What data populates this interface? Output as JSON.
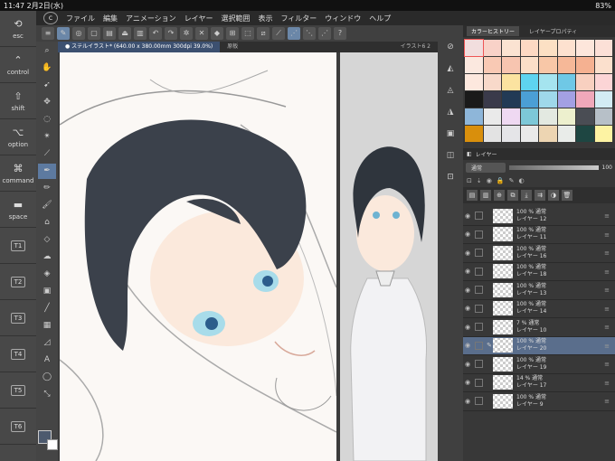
{
  "status": {
    "time": "11:47",
    "date": "2月2日(水)",
    "battery": "83%"
  },
  "menu": [
    "ファイル",
    "編集",
    "アニメーション",
    "レイヤー",
    "選択範囲",
    "表示",
    "フィルター",
    "ウィンドウ",
    "ヘルプ"
  ],
  "tabs": [
    {
      "label": "● ステルイラスト* (640.00 x 380.00mm 300dpi 39.0%)",
      "active": true
    },
    {
      "label": "原板",
      "active": false
    },
    {
      "label": "イラスト6 2",
      "active": false
    }
  ],
  "commands": [
    {
      "sym": "⟲",
      "label": "esc"
    },
    {
      "sym": "⌃",
      "label": "control"
    },
    {
      "sym": "⇧",
      "label": "shift"
    },
    {
      "sym": "⌥",
      "label": "option"
    },
    {
      "sym": "⌘",
      "label": "command"
    },
    {
      "sym": "▬",
      "label": "space"
    },
    {
      "sym": "",
      "label": "T1"
    },
    {
      "sym": "",
      "label": "T2"
    },
    {
      "sym": "",
      "label": "T3"
    },
    {
      "sym": "",
      "label": "T4"
    },
    {
      "sym": "",
      "label": "T5"
    },
    {
      "sym": "",
      "label": "T6"
    }
  ],
  "color_history": {
    "tab": "カラーヒストリー",
    "tab2": "レイヤープロパティ",
    "colors": [
      "#f2dede",
      "#f9d2c8",
      "#fbe3d2",
      "#fdd9c3",
      "#fce0c4",
      "#fde1cf",
      "#fde6db",
      "#fce0d7",
      "#fbe8df",
      "#f9c9b4",
      "#f7c5b0",
      "#fbdfc8",
      "#f8c7a7",
      "#f6b898",
      "#f5b191",
      "#fbe0cd",
      "#fde8de",
      "#f8d9ca",
      "#fbe3a0",
      "#5ed4f0",
      "#a5e4ef",
      "#6fc8e6",
      "#f8d0c0",
      "#fcd5d6",
      "#1a1a1a",
      "#3a3a4a",
      "#223a55",
      "#4b9fd5",
      "#9fd8ea",
      "#a3a0e3",
      "#f0a8ba",
      "#d3ecf4",
      "#8eb6d9",
      "#eaeaea",
      "#efd9f2",
      "#7dc8d8",
      "#e3e9e1",
      "#edf0ce",
      "#4a4d54",
      "#b7c0c8",
      "#d98f0c",
      "#e3e3e3",
      "#e5e5e8",
      "#e9e9e9",
      "#edd5b2",
      "#e9ece9",
      "#1e4642",
      "#fdf3a3"
    ]
  },
  "layer_panel": {
    "title": "レイヤー",
    "blend_mode": "通常",
    "opacity": "100",
    "layers": [
      {
        "opacity": "100 %",
        "mode": "通常",
        "name": "レイヤー 12",
        "selected": false
      },
      {
        "opacity": "100 %",
        "mode": "通常",
        "name": "レイヤー 11",
        "selected": false
      },
      {
        "opacity": "100 %",
        "mode": "通常",
        "name": "レイヤー 16",
        "selected": false
      },
      {
        "opacity": "100 %",
        "mode": "通常",
        "name": "レイヤー 18",
        "selected": false
      },
      {
        "opacity": "100 %",
        "mode": "通常",
        "name": "レイヤー 13",
        "selected": false
      },
      {
        "opacity": "100 %",
        "mode": "通常",
        "name": "レイヤー 14",
        "selected": false
      },
      {
        "opacity": "7 %",
        "mode": "通常",
        "name": "レイヤー 10",
        "selected": false
      },
      {
        "opacity": "100 %",
        "mode": "通常",
        "name": "レイヤー 20",
        "selected": true
      },
      {
        "opacity": "100 %",
        "mode": "通常",
        "name": "レイヤー 19",
        "selected": false
      },
      {
        "opacity": "14 %",
        "mode": "通常",
        "name": "レイヤー 17",
        "selected": false
      },
      {
        "opacity": "100 %",
        "mode": "通常",
        "name": "レイヤー 9",
        "selected": false
      }
    ]
  },
  "colors": {
    "accent": "#5d7aa0",
    "main_color": "#4d5a6e",
    "sub_color": "#ffffff"
  }
}
